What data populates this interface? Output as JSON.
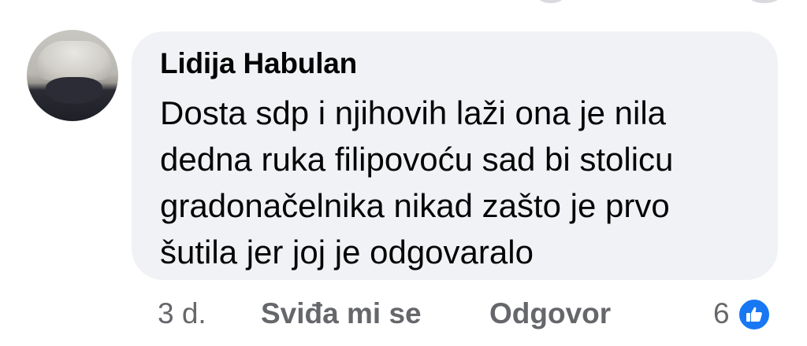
{
  "comment": {
    "author": "Lidija Habulan",
    "text_lines": [
      "Dosta sdp i njihovih laži ona je nila",
      "dedna ruka filipovoću sad bi stolicu",
      "gradonačelnika nikad zašto je prvo",
      "šutila jer joj je odgovaralo"
    ],
    "avatar_icon": "user-avatar"
  },
  "actions": {
    "timestamp": "3 d.",
    "like_label": "Sviđa mi se",
    "reply_label": "Odgovor",
    "reaction_count": "6",
    "reaction_icon": "like-thumb-icon"
  },
  "colors": {
    "bubble": "#f0f2f5",
    "text": "#050505",
    "secondary_text": "#65676b",
    "like_blue": "#1877f2"
  }
}
